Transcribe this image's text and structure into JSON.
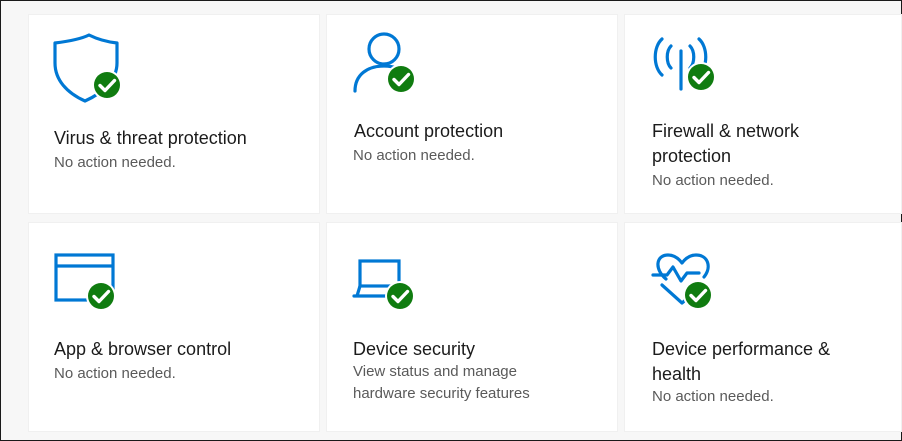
{
  "tiles": [
    {
      "icon": "shield-check-icon",
      "title": "Virus & threat protection",
      "status": "No action needed."
    },
    {
      "icon": "person-check-icon",
      "title": "Account protection",
      "status": "No action needed."
    },
    {
      "icon": "antenna-check-icon",
      "title": "Firewall & network protection",
      "status": "No action needed."
    },
    {
      "icon": "browser-window-check-icon",
      "title": "App & browser control",
      "status": "No action needed."
    },
    {
      "icon": "laptop-check-icon",
      "title": "Device security",
      "status": "View status and manage hardware security features"
    },
    {
      "icon": "heart-pulse-check-icon",
      "title": "Device performance & health",
      "status": "No action needed."
    }
  ],
  "colors": {
    "accent": "#0078d4",
    "ok_badge": "#107c10",
    "title_text": "#1b1b1b",
    "status_text": "#5a5a5a"
  }
}
